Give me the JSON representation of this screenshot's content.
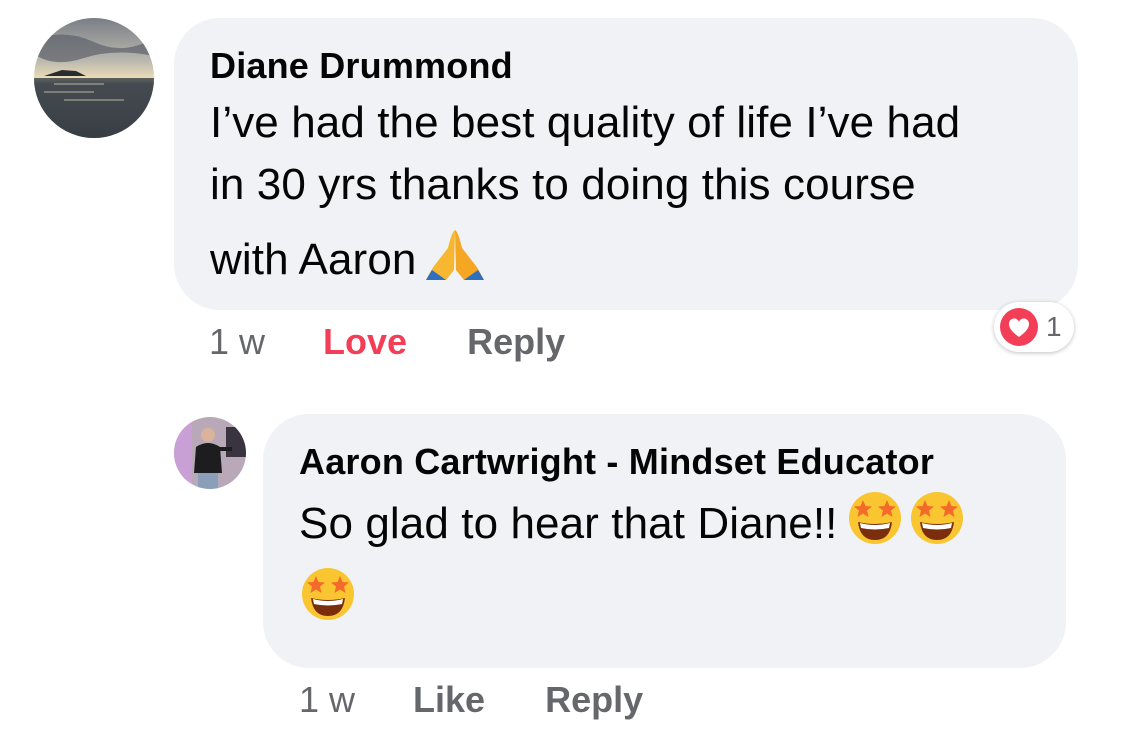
{
  "comments": [
    {
      "author": "Diane Drummond",
      "lines": [
        "I’ve had the best quality of life I’ve had",
        "in 30 yrs thanks to doing this course",
        "with Aaron"
      ],
      "emoji": "folded-hands",
      "time": "1 w",
      "reaction_action": "Love",
      "reply": "Reply",
      "reaction": {
        "icon": "heart-icon",
        "color": "#f33e58",
        "count": "1"
      }
    },
    {
      "author": "Aaron Cartwright - Mindset Educator",
      "lines": [
        "So glad to hear that Diane!!"
      ],
      "emoji": "star-struck",
      "emoji_count": 3,
      "time": "1 w",
      "reaction_action": "Like",
      "reply": "Reply"
    }
  ],
  "colors": {
    "bubble": "#f0f2f5",
    "secondary_text": "#65676b",
    "love": "#f33e58"
  }
}
